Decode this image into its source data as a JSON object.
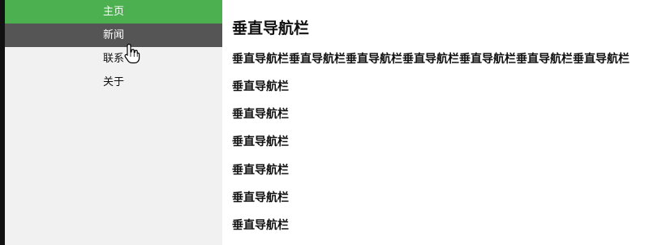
{
  "sidebar": {
    "items": [
      {
        "label": "主页",
        "state": "active"
      },
      {
        "label": "新闻",
        "state": "hover"
      },
      {
        "label": "联系",
        "state": "normal"
      },
      {
        "label": "关于",
        "state": "normal"
      }
    ]
  },
  "main": {
    "title": "垂直导航栏",
    "paragraphs": [
      "垂直导航栏垂直导航栏垂直导航栏垂直导航栏垂直导航栏垂直导航栏垂直导航栏",
      "垂直导航栏",
      "垂直导航栏",
      "垂直导航栏",
      "垂直导航栏",
      "垂直导航栏",
      "垂直导航栏"
    ]
  },
  "colors": {
    "active": "#4caf50",
    "hover": "#555555",
    "sidebar_bg": "#f1f1f1"
  },
  "icons": {
    "cursor": "hand-pointer-cursor-icon"
  }
}
